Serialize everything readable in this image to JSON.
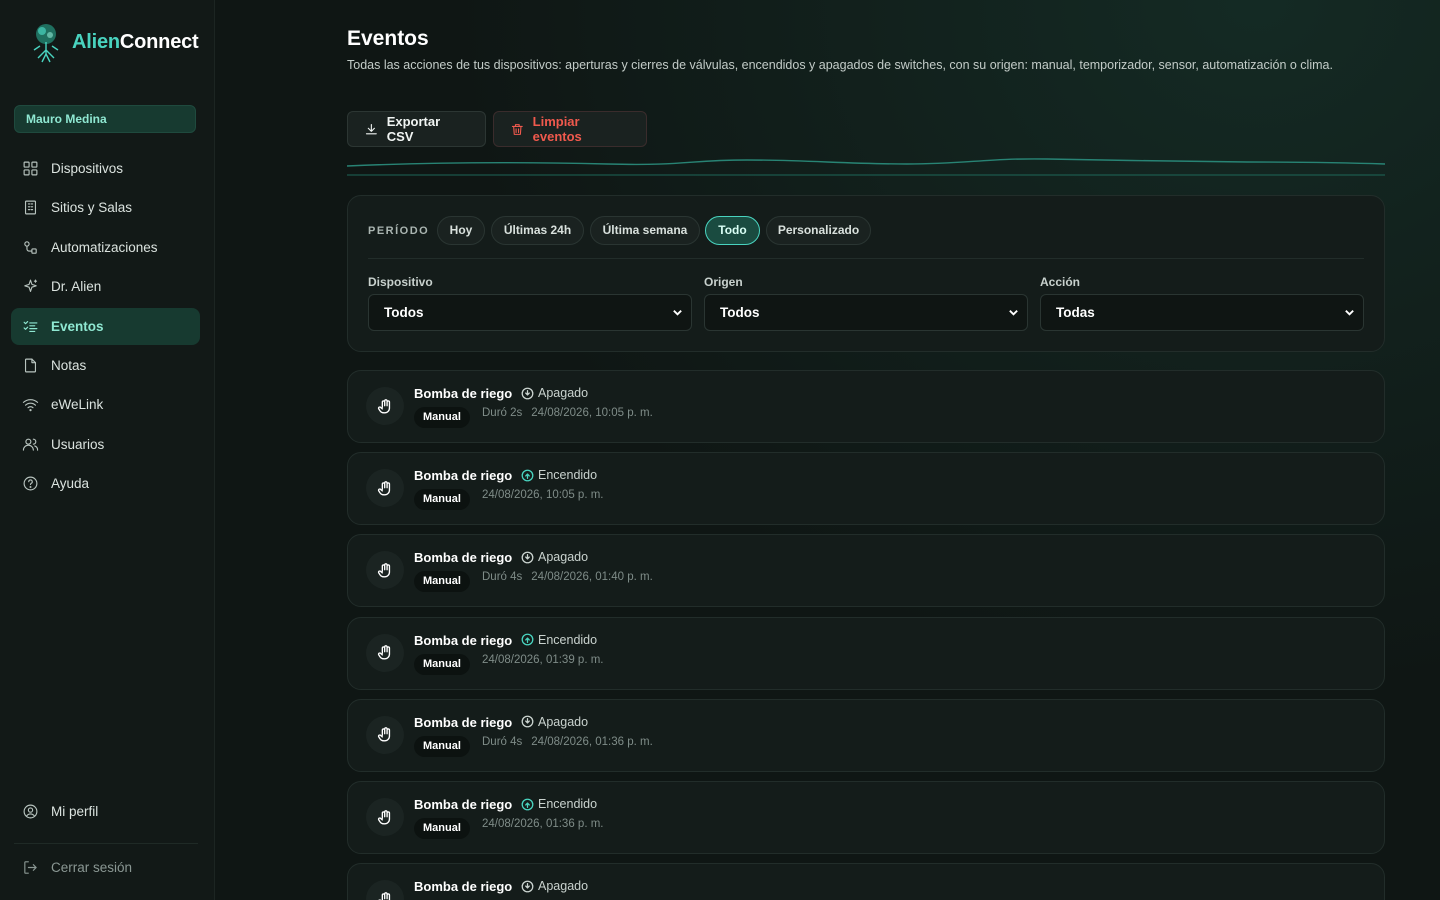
{
  "brand": {
    "name_part1": "Alien",
    "name_part2": "Connect"
  },
  "user": {
    "name": "Mauro Medina"
  },
  "nav": [
    {
      "label": "Dispositivos",
      "icon": "grid-icon",
      "active": false
    },
    {
      "label": "Sitios y Salas",
      "icon": "building-icon",
      "active": false
    },
    {
      "label": "Automatizaciones",
      "icon": "automation-icon",
      "active": false
    },
    {
      "label": "Dr. Alien",
      "icon": "sparkle-icon",
      "active": false
    },
    {
      "label": "Eventos",
      "icon": "list-check-icon",
      "active": true
    },
    {
      "label": "Notas",
      "icon": "note-icon",
      "active": false
    },
    {
      "label": "eWeLink",
      "icon": "wifi-icon",
      "active": false
    },
    {
      "label": "Usuarios",
      "icon": "users-icon",
      "active": false
    },
    {
      "label": "Ayuda",
      "icon": "help-icon",
      "active": false
    }
  ],
  "profile_label": "Mi perfil",
  "logout_label": "Cerrar sesión",
  "page": {
    "title": "Eventos",
    "subtitle": "Todas las acciones de tus dispositivos: aperturas y cierres de válvulas, encendidos y apagados de switches, con su origen: manual, temporizador, sensor, automatización o clima."
  },
  "toolbar": {
    "export_label": "Exportar CSV",
    "clear_label": "Limpiar eventos"
  },
  "filters": {
    "period_label": "PERÍODO",
    "chips": [
      "Hoy",
      "Últimas 24h",
      "Última semana",
      "Todo",
      "Personalizado"
    ],
    "active_chip": "Todo",
    "device_label": "Dispositivo",
    "device_value": "Todos",
    "origin_label": "Origen",
    "origin_value": "Todos",
    "action_label": "Acción",
    "action_value": "Todas"
  },
  "colors": {
    "accent": "#49d3bf",
    "danger": "#f0594d",
    "background": "#0f1614"
  },
  "events": [
    {
      "device": "Bomba de riego",
      "action": "Apagado",
      "state": "off",
      "origin": "Manual",
      "duration": "Duró 2s",
      "timestamp": "24/08/2026, 10:05 p. m."
    },
    {
      "device": "Bomba de riego",
      "action": "Encendido",
      "state": "on",
      "origin": "Manual",
      "duration": "",
      "timestamp": "24/08/2026, 10:05 p. m."
    },
    {
      "device": "Bomba de riego",
      "action": "Apagado",
      "state": "off",
      "origin": "Manual",
      "duration": "Duró 4s",
      "timestamp": "24/08/2026, 01:40 p. m."
    },
    {
      "device": "Bomba de riego",
      "action": "Encendido",
      "state": "on",
      "origin": "Manual",
      "duration": "",
      "timestamp": "24/08/2026, 01:39 p. m."
    },
    {
      "device": "Bomba de riego",
      "action": "Apagado",
      "state": "off",
      "origin": "Manual",
      "duration": "Duró 4s",
      "timestamp": "24/08/2026, 01:36 p. m."
    },
    {
      "device": "Bomba de riego",
      "action": "Encendido",
      "state": "on",
      "origin": "Manual",
      "duration": "",
      "timestamp": "24/08/2026, 01:36 p. m."
    },
    {
      "device": "Bomba de riego",
      "action": "Apagado",
      "state": "off",
      "origin": "",
      "duration": "",
      "timestamp": ""
    }
  ]
}
